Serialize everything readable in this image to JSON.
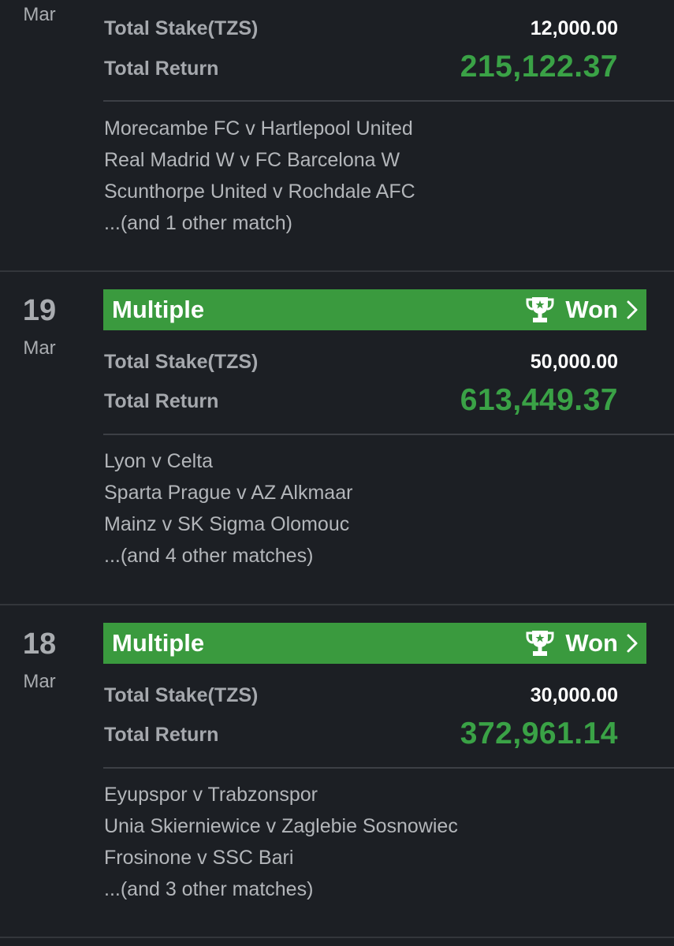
{
  "colors": {
    "background": "#1c1f24",
    "won_banner": "#3a9a3e",
    "return_green": "#3aa246",
    "label_gray": "#a5a8ad"
  },
  "bets": [
    {
      "day": "",
      "month": "Mar",
      "type": "",
      "status": "",
      "stake_label": "Total Stake(TZS)",
      "stake": "12,000.00",
      "return_label": "Total Return",
      "total_return": "215,122.37",
      "matches": [
        "Morecambe FC v Hartlepool United",
        "Real Madrid W v FC Barcelona W",
        "Scunthorpe United v Rochdale AFC",
        "...(and 1 other match)"
      ]
    },
    {
      "day": "19",
      "month": "Mar",
      "type": "Multiple",
      "status": "Won",
      "icon": "trophy-icon",
      "stake_label": "Total Stake(TZS)",
      "stake": "50,000.00",
      "return_label": "Total Return",
      "total_return": "613,449.37",
      "matches": [
        "Lyon v Celta",
        "Sparta Prague v AZ Alkmaar",
        "Mainz v SK Sigma Olomouc",
        "...(and 4 other matches)"
      ]
    },
    {
      "day": "18",
      "month": "Mar",
      "type": "Multiple",
      "status": "Won",
      "icon": "trophy-icon",
      "stake_label": "Total Stake(TZS)",
      "stake": "30,000.00",
      "return_label": "Total Return",
      "total_return": "372,961.14",
      "matches": [
        "Eyupspor v Trabzonspor",
        "Unia Skierniewice v Zaglebie Sosnowiec",
        "Frosinone v SSC Bari",
        "...(and 3 other matches)"
      ]
    }
  ]
}
